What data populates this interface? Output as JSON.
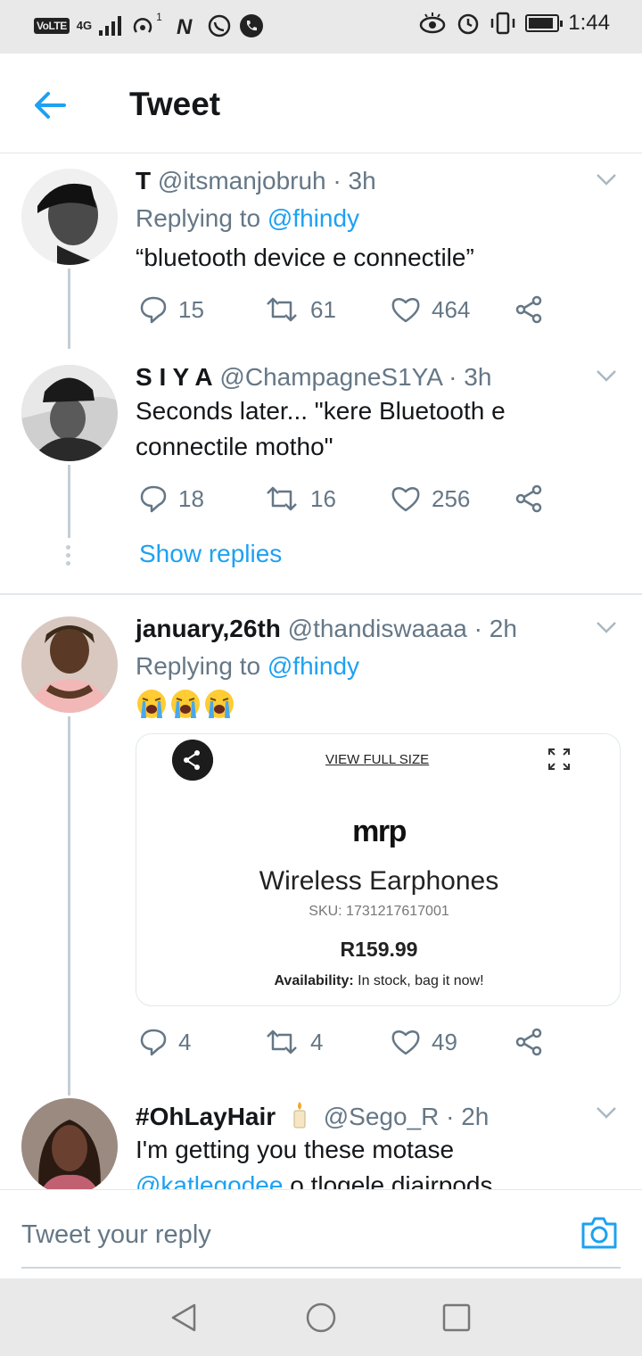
{
  "status_bar": {
    "network_badge": "VoLTE",
    "network_type": "4G",
    "notification_count": "1",
    "time": "1:44"
  },
  "header": {
    "back_icon": "arrow-left-icon",
    "title": "Tweet"
  },
  "colors": {
    "accent": "#1da1f2",
    "muted": "#657786",
    "text": "#14171a",
    "divider": "#e1e8ed",
    "thread_line": "#c4cfd6"
  },
  "tweets": [
    {
      "name": "T",
      "handle": "@itsmanjobruh",
      "time": "· 3h",
      "replying_label": "Replying to",
      "replying_to": "@fhindy",
      "text": "“bluetooth device e connectile”",
      "replies": "15",
      "retweets": "61",
      "likes": "464"
    },
    {
      "name": "S I Y A",
      "handle": "@ChampagneS1YA",
      "time": "· 3h",
      "text": "Seconds later... \"kere Bluetooth e connectile motho\"",
      "replies": "18",
      "retweets": "16",
      "likes": "256"
    },
    {
      "name": "january,26th",
      "handle": "@thandiswaaaa",
      "time": "· 2h",
      "replying_label": "Replying to",
      "replying_to": "@fhindy",
      "emojis": [
        "loudly-crying-face",
        "loudly-crying-face",
        "loudly-crying-face"
      ],
      "replies": "4",
      "retweets": "4",
      "likes": "49",
      "image_card": {
        "view_full_size": "VIEW FULL SIZE",
        "brand": "mrp",
        "product": "Wireless Earphones",
        "sku": "SKU: 1731217617001",
        "price": "R159.99",
        "availability_label": "Availability:",
        "availability_value": " In stock, bag it now!"
      }
    },
    {
      "name": "#OhLayHair",
      "name_emoji": "candle",
      "handle": "@Sego_R",
      "time": "· 2h",
      "text_line1": "I'm getting you these motase",
      "text_line2_link": "@katlegodee",
      "text_line2_rest": "  o tlogele diairpods"
    }
  ],
  "show_replies": "Show replies",
  "composer": {
    "placeholder": "Tweet your reply",
    "camera_icon": "camera-icon"
  },
  "nav_bar": {
    "back": "nav-back-icon",
    "home": "nav-home-icon",
    "recents": "nav-recents-icon"
  }
}
